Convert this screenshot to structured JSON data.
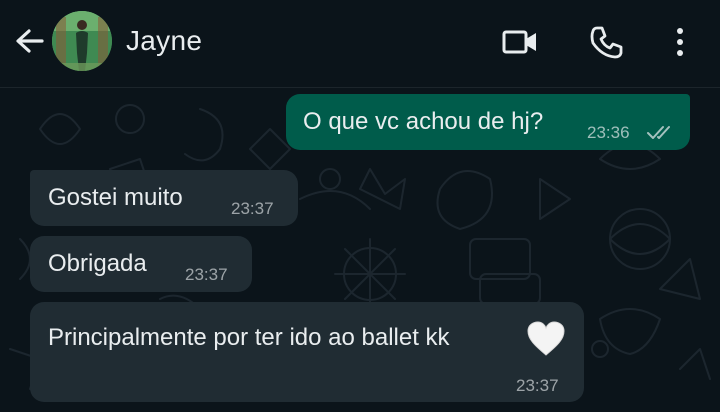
{
  "header": {
    "contact_name": "Jayne",
    "icons": [
      "back-arrow-icon",
      "video-call-icon",
      "phone-icon",
      "more-vertical-icon"
    ]
  },
  "messages": [
    {
      "direction": "outgoing",
      "text": "O que vc achou de hj?",
      "time": "23:36",
      "status": "read"
    },
    {
      "direction": "incoming",
      "text": "Gostei muito",
      "time": "23:37"
    },
    {
      "direction": "incoming",
      "text": "Obrigada",
      "time": "23:37"
    },
    {
      "direction": "incoming",
      "text": "Principalmente por ter ido ao ballet kk",
      "emoji": "white-heart",
      "time": "23:37"
    }
  ],
  "colors": {
    "background": "#0b141a",
    "outgoing_bubble": "#005c4b",
    "incoming_bubble": "#202c33",
    "text": "#e9edef"
  }
}
